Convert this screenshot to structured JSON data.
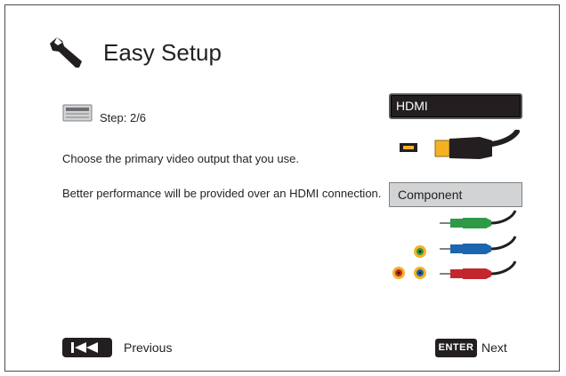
{
  "header": {
    "title": "Easy Setup",
    "icon": "wrench-icon"
  },
  "step": {
    "text": "Step: 2/6",
    "icon": "display-panel-icon"
  },
  "instructions": {
    "line1": "Choose the primary video output that you use.",
    "line2": "Better performance will be provided over an HDMI connection."
  },
  "options": [
    {
      "label": "HDMI",
      "selected": true,
      "icon": "hdmi-cable-icon"
    },
    {
      "label": "Component",
      "selected": false,
      "icon": "component-cable-icon"
    }
  ],
  "footer": {
    "previous_label": "Previous",
    "previous_key_icon": "skip-previous-icon",
    "enter_key": "ENTER",
    "next_label": "Next"
  },
  "colors": {
    "selected_bg": "#231f20",
    "unselected_bg": "#d1d3d4",
    "cable_green": "#2e9a47",
    "cable_blue": "#1c66b0",
    "cable_red": "#c4262e",
    "hdmi_gold": "#f4b223"
  }
}
